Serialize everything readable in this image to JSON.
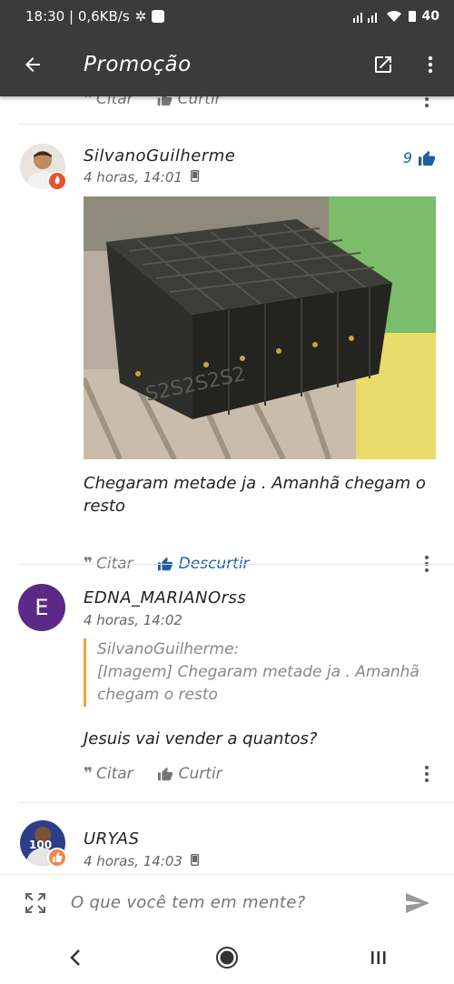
{
  "status_bar": {
    "time_speed": "18:30 | 0,6KB/s",
    "battery": "40"
  },
  "app_bar": {
    "title": "Promoção"
  },
  "prev_post": {
    "quote_label": "Citar",
    "like_label": "Curtir"
  },
  "posts": [
    {
      "author": "SilvanoGuilherme",
      "timestamp": "4 horas, 14:01",
      "likes": "9",
      "image_caption": "",
      "text": "Chegaram metade ja . Amanhã chegam o resto",
      "quote_label": "Citar",
      "like_label": "Descurtir"
    },
    {
      "author": "EDNA_MARIANOrss",
      "avatar_letter": "E",
      "timestamp": "4 horas, 14:02",
      "quote_author": "SilvanoGuilherme:",
      "quote_text": "[Imagem] Chegaram metade ja . Amanhã chegam o resto",
      "text": "Jesuis vai vender a quantos?",
      "quote_label": "Citar",
      "like_label": "Curtir"
    },
    {
      "author": "URYAS",
      "timestamp": "4 horas, 14:03",
      "avatar_badge": "100"
    }
  ],
  "composer": {
    "placeholder": "O que você tem em mente?"
  },
  "colors": {
    "app_bar": "#3b3b3b",
    "accent": "#1c5fa5",
    "quote_bar": "#f2a43a",
    "avatar_purple": "#5b2a86"
  }
}
